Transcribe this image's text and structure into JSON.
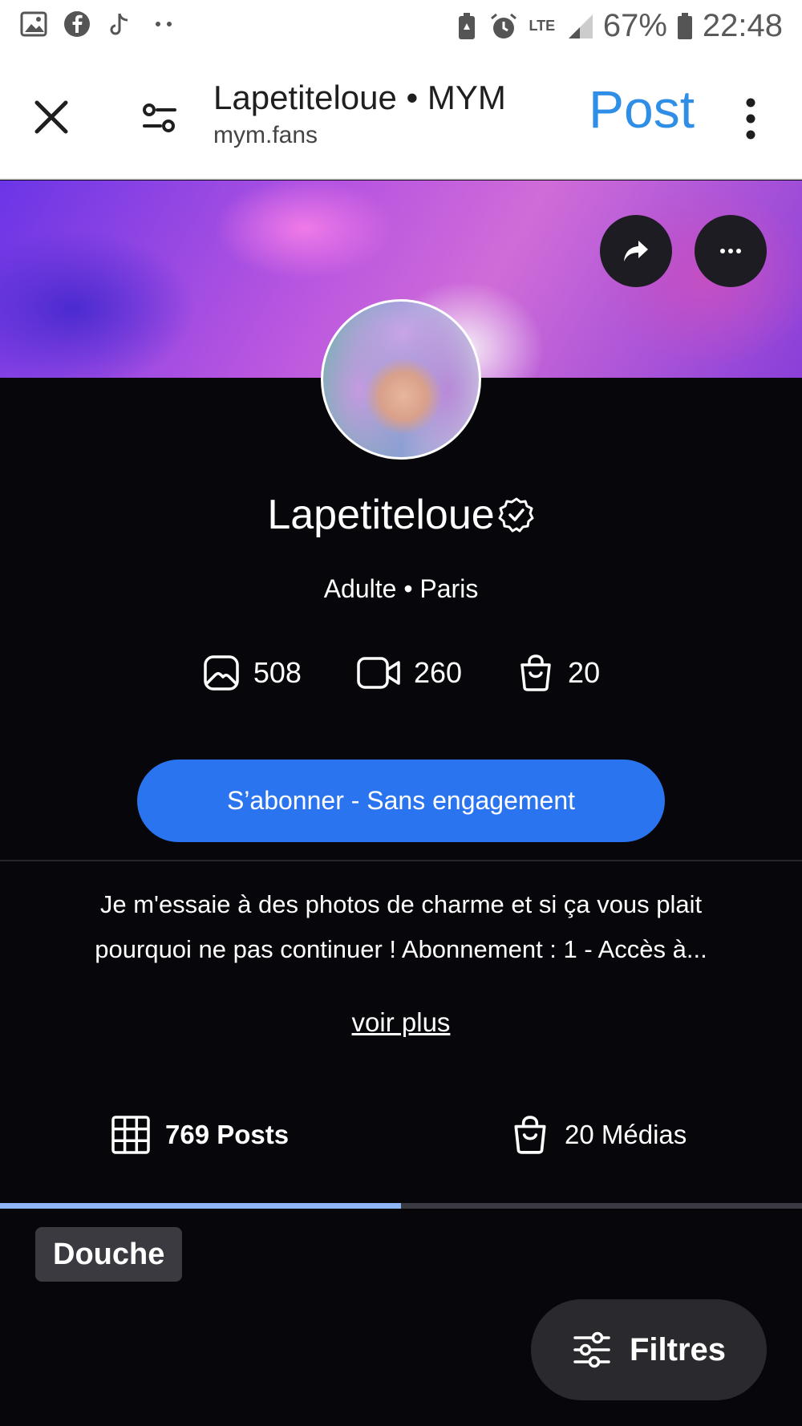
{
  "status_bar": {
    "icons_left": [
      "gallery-icon",
      "facebook-icon",
      "tiktok-icon",
      "more-dots-icon"
    ],
    "icons_right": [
      "battery-saver-icon",
      "alarm-icon",
      "lte-icon",
      "signal-icon",
      "battery-icon"
    ],
    "lte_label": "LTE",
    "battery": "67%",
    "time": "22:48"
  },
  "browser": {
    "title": "Lapetiteloue • MYM",
    "url": "mym.fans",
    "post_label": "Post",
    "accent": "#2f8fe6"
  },
  "profile": {
    "name": "Lapetiteloue",
    "subtitle": "Adulte • Paris",
    "stats": {
      "photos": "508",
      "videos": "260",
      "medias": "20"
    },
    "subscribe_label": "S’abonner - Sans engagement",
    "subscribe_color": "#2b74f0",
    "bio_line1": "Je m'essaie à des photos de charme et si ça vous plait",
    "bio_line2": "pourquoi ne pas continuer ! Abonnement : 1 - Accès à...",
    "more_label": "voir plus"
  },
  "tabs": {
    "posts_label": "769 Posts",
    "medias_label": "20 Médias",
    "active": "posts"
  },
  "chip_label": "Douche",
  "filters_label": "Filtres"
}
